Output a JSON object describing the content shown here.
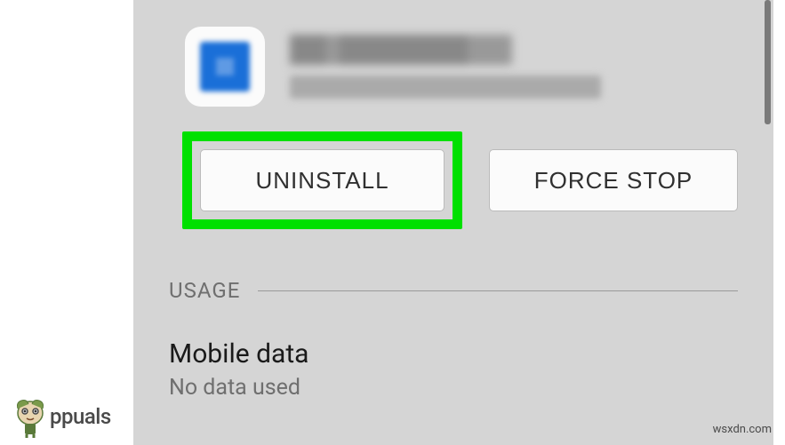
{
  "app_info": {
    "name": "[blurred]",
    "version": "[blurred]"
  },
  "buttons": {
    "uninstall": "UNINSTALL",
    "force_stop": "FORCE STOP"
  },
  "usage_section": {
    "header": "USAGE",
    "mobile_data": {
      "title": "Mobile data",
      "subtitle": "No data used"
    }
  },
  "watermark": {
    "brand": "ppuals",
    "source": "wsxdn.com"
  }
}
